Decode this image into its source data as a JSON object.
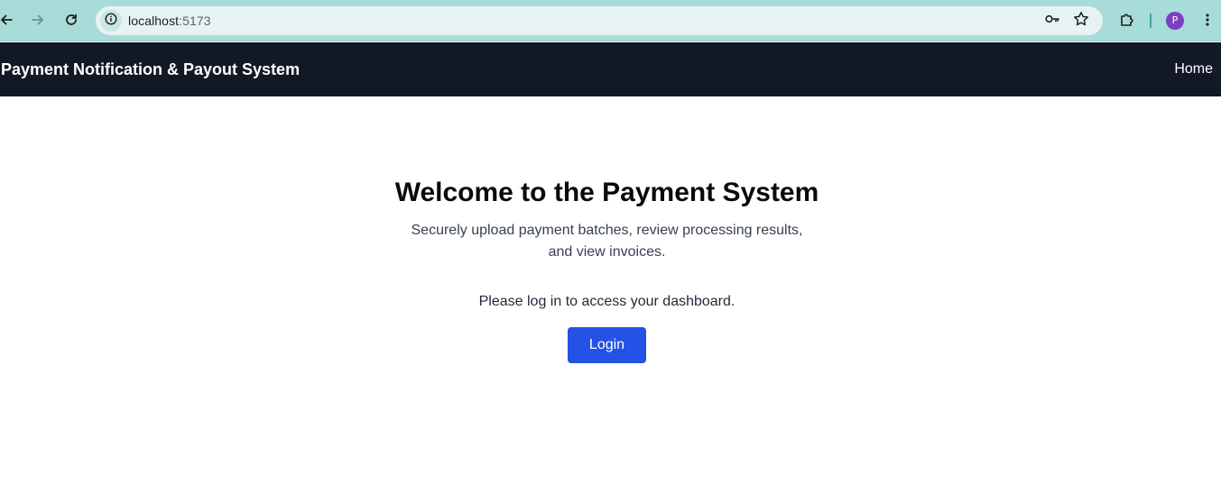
{
  "browser": {
    "url_host": "localhost",
    "url_port": ":5173",
    "profile_initial": "P",
    "icons": {
      "back": "arrow-left-icon",
      "forward": "arrow-right-icon",
      "reload": "reload-icon",
      "site_info": "info-icon",
      "password": "key-icon",
      "bookmark": "star-icon",
      "extensions": "puzzle-icon",
      "menu": "kebab-menu-icon"
    },
    "colors": {
      "frame": "#a8dcd9",
      "omnibox": "#e7f3f2",
      "avatar": "#7b3fc4"
    }
  },
  "navbar": {
    "brand": "Payment Notification & Payout System",
    "home_link": "Home",
    "background": "#121826"
  },
  "hero": {
    "title": "Welcome to the Payment System",
    "subtitle": "Securely upload payment batches, review processing results, and view invoices.",
    "login_prompt": "Please log in to access your dashboard.",
    "login_button": "Login",
    "button_color": "#2452e5"
  }
}
